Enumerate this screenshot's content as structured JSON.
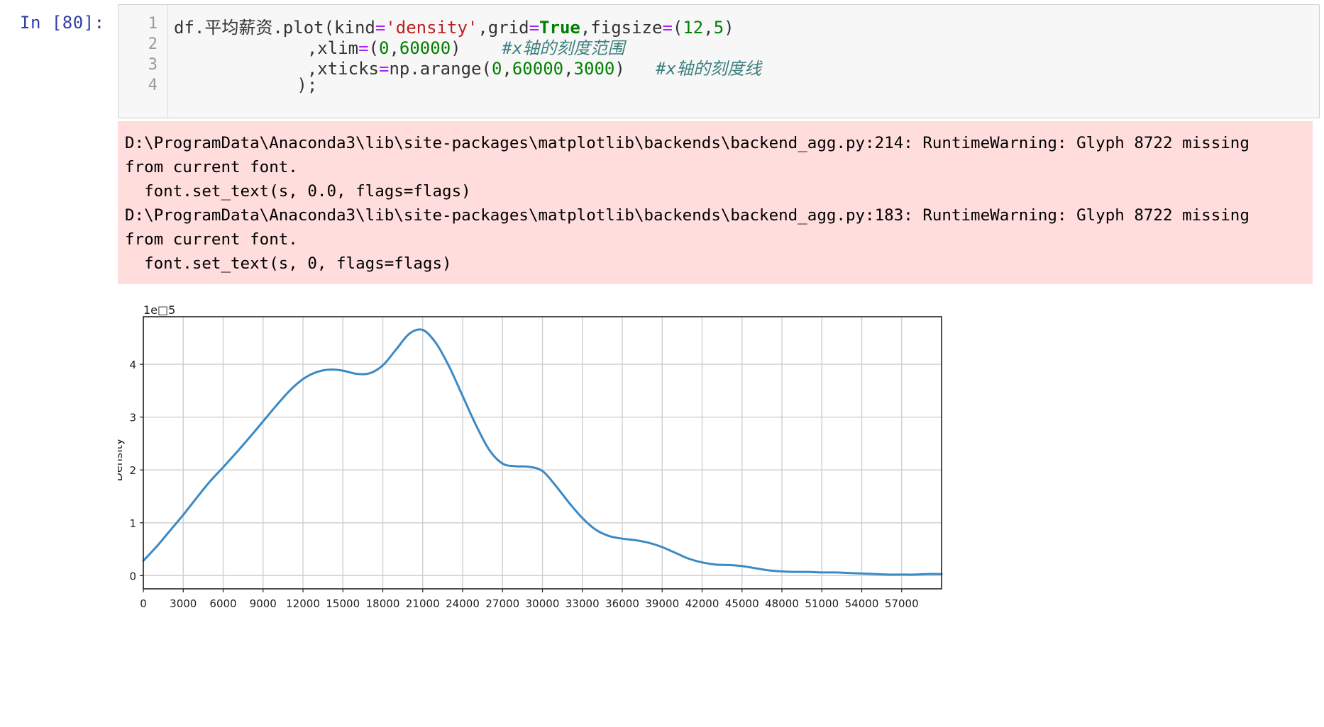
{
  "cell": {
    "prompt": "In  [80]:",
    "line_numbers": [
      "1",
      "2",
      "3",
      "4"
    ],
    "code": {
      "l1_a": "df.平均薪资.plot(kind",
      "l1_eq1": "=",
      "l1_str": "'density'",
      "l1_b": ",grid",
      "l1_eq2": "=",
      "l1_kw": "True",
      "l1_c": ",figsize",
      "l1_eq3": "=",
      "l1_d": "(",
      "l1_n1": "12",
      "l1_e": ",",
      "l1_n2": "5",
      "l1_f": ")",
      "l2_a": "             ,xlim",
      "l2_eq": "=",
      "l2_b": "(",
      "l2_n1": "0",
      "l2_c": ",",
      "l2_n2": "60000",
      "l2_d": ")    ",
      "l2_cm": "#x轴的刻度范围",
      "l3_a": "             ,xticks",
      "l3_eq": "=",
      "l3_b": "np.arange(",
      "l3_n1": "0",
      "l3_c": ",",
      "l3_n2": "60000",
      "l3_d": ",",
      "l3_n3": "3000",
      "l3_e": ")   ",
      "l3_cm": "#x轴的刻度线",
      "l4": "            );"
    }
  },
  "stderr": {
    "lines": [
      "D:\\ProgramData\\Anaconda3\\lib\\site-packages\\matplotlib\\backends\\backend_agg.py:214: RuntimeWarning: Glyph 8722 missing",
      "from current font.",
      "  font.set_text(s, 0.0, flags=flags)",
      "D:\\ProgramData\\Anaconda3\\lib\\site-packages\\matplotlib\\backends\\backend_agg.py:183: RuntimeWarning: Glyph 8722 missing",
      "from current font.",
      "  font.set_text(s, 0, flags=flags)"
    ]
  },
  "chart_data": {
    "type": "line",
    "title": "",
    "xlabel": "",
    "ylabel": "Density",
    "offset_text": "1e□5",
    "xlim": [
      0,
      60000
    ],
    "ylim": [
      -0.25,
      4.9
    ],
    "x_ticks": [
      "0",
      "3000",
      "6000",
      "9000",
      "12000",
      "15000",
      "18000",
      "21000",
      "24000",
      "27000",
      "30000",
      "33000",
      "36000",
      "39000",
      "42000",
      "45000",
      "48000",
      "51000",
      "54000",
      "57000"
    ],
    "x_tick_values": [
      0,
      3000,
      6000,
      9000,
      12000,
      15000,
      18000,
      21000,
      24000,
      27000,
      30000,
      33000,
      36000,
      39000,
      42000,
      45000,
      48000,
      51000,
      54000,
      57000
    ],
    "y_ticks": [
      "0",
      "1",
      "2",
      "3",
      "4"
    ],
    "y_tick_values": [
      0,
      1,
      2,
      3,
      4
    ],
    "grid": true,
    "line_color": "#3c8ac4",
    "series": [
      {
        "x": [
          0,
          1000,
          2000,
          3000,
          4000,
          5000,
          6000,
          7000,
          8000,
          9000,
          10000,
          11000,
          12000,
          13000,
          14000,
          15000,
          16000,
          17000,
          18000,
          19000,
          20000,
          21000,
          22000,
          23000,
          24000,
          25000,
          26000,
          27000,
          28000,
          29000,
          30000,
          31000,
          32000,
          33000,
          34000,
          35000,
          36000,
          37000,
          38000,
          39000,
          40000,
          41000,
          42000,
          43000,
          44000,
          45000,
          46000,
          47000,
          48000,
          49000,
          50000,
          51000,
          52000,
          53000,
          54000,
          55000,
          56000,
          57000,
          58000,
          59000,
          60000
        ],
        "y": [
          0.28,
          0.55,
          0.85,
          1.15,
          1.47,
          1.78,
          2.05,
          2.33,
          2.62,
          2.92,
          3.22,
          3.5,
          3.72,
          3.85,
          3.9,
          3.88,
          3.82,
          3.83,
          3.98,
          4.28,
          4.58,
          4.65,
          4.4,
          3.95,
          3.4,
          2.85,
          2.38,
          2.12,
          2.07,
          2.06,
          1.98,
          1.7,
          1.38,
          1.09,
          0.87,
          0.75,
          0.7,
          0.67,
          0.62,
          0.54,
          0.43,
          0.32,
          0.25,
          0.21,
          0.2,
          0.18,
          0.14,
          0.1,
          0.08,
          0.07,
          0.07,
          0.06,
          0.06,
          0.05,
          0.04,
          0.03,
          0.02,
          0.02,
          0.02,
          0.03,
          0.03
        ]
      }
    ]
  }
}
